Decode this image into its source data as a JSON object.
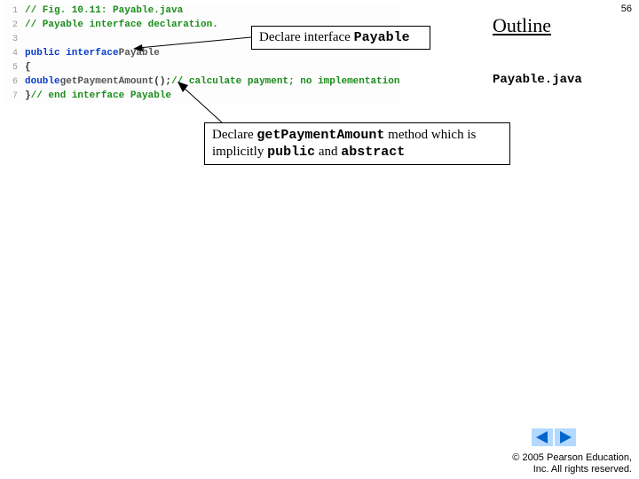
{
  "page_number": "56",
  "outline_heading": "Outline",
  "filename": "Payable.java",
  "code": {
    "lines": [
      {
        "n": "1",
        "frags": [
          {
            "cls": "cmt",
            "t": "// Fig. 10.11: Payable.java"
          }
        ]
      },
      {
        "n": "2",
        "frags": [
          {
            "cls": "cmt",
            "t": "// Payable interface declaration."
          }
        ]
      },
      {
        "n": "3",
        "frags": []
      },
      {
        "n": "4",
        "frags": [
          {
            "cls": "kw",
            "t": "public interface"
          },
          {
            "cls": "pl",
            "t": " "
          },
          {
            "cls": "id",
            "t": "Payable"
          }
        ]
      },
      {
        "n": "5",
        "frags": [
          {
            "cls": "pl",
            "t": "{"
          }
        ]
      },
      {
        "n": "6",
        "frags": [
          {
            "cls": "pl",
            "t": "   "
          },
          {
            "cls": "typ",
            "t": "double"
          },
          {
            "cls": "pl",
            "t": " "
          },
          {
            "cls": "id",
            "t": "getPaymentAmount"
          },
          {
            "cls": "pl",
            "t": "(); "
          },
          {
            "cls": "cmt",
            "t": "// calculate payment; no implementation"
          }
        ]
      },
      {
        "n": "7",
        "frags": [
          {
            "cls": "pl",
            "t": "} "
          },
          {
            "cls": "cmt",
            "t": "// end interface Payable"
          }
        ]
      }
    ]
  },
  "callout1_pre": "Declare interface ",
  "callout1_mono": "Payable",
  "callout2_pre": "Declare ",
  "callout2_mono1": "getPaymentAmount",
  "callout2_mid": " method which is implicitly ",
  "callout2_mono2": "public",
  "callout2_and": " and ",
  "callout2_mono3": "abstract",
  "copyright_l1": "© 2005 Pearson Education,",
  "copyright_l2": "Inc.  All rights reserved."
}
